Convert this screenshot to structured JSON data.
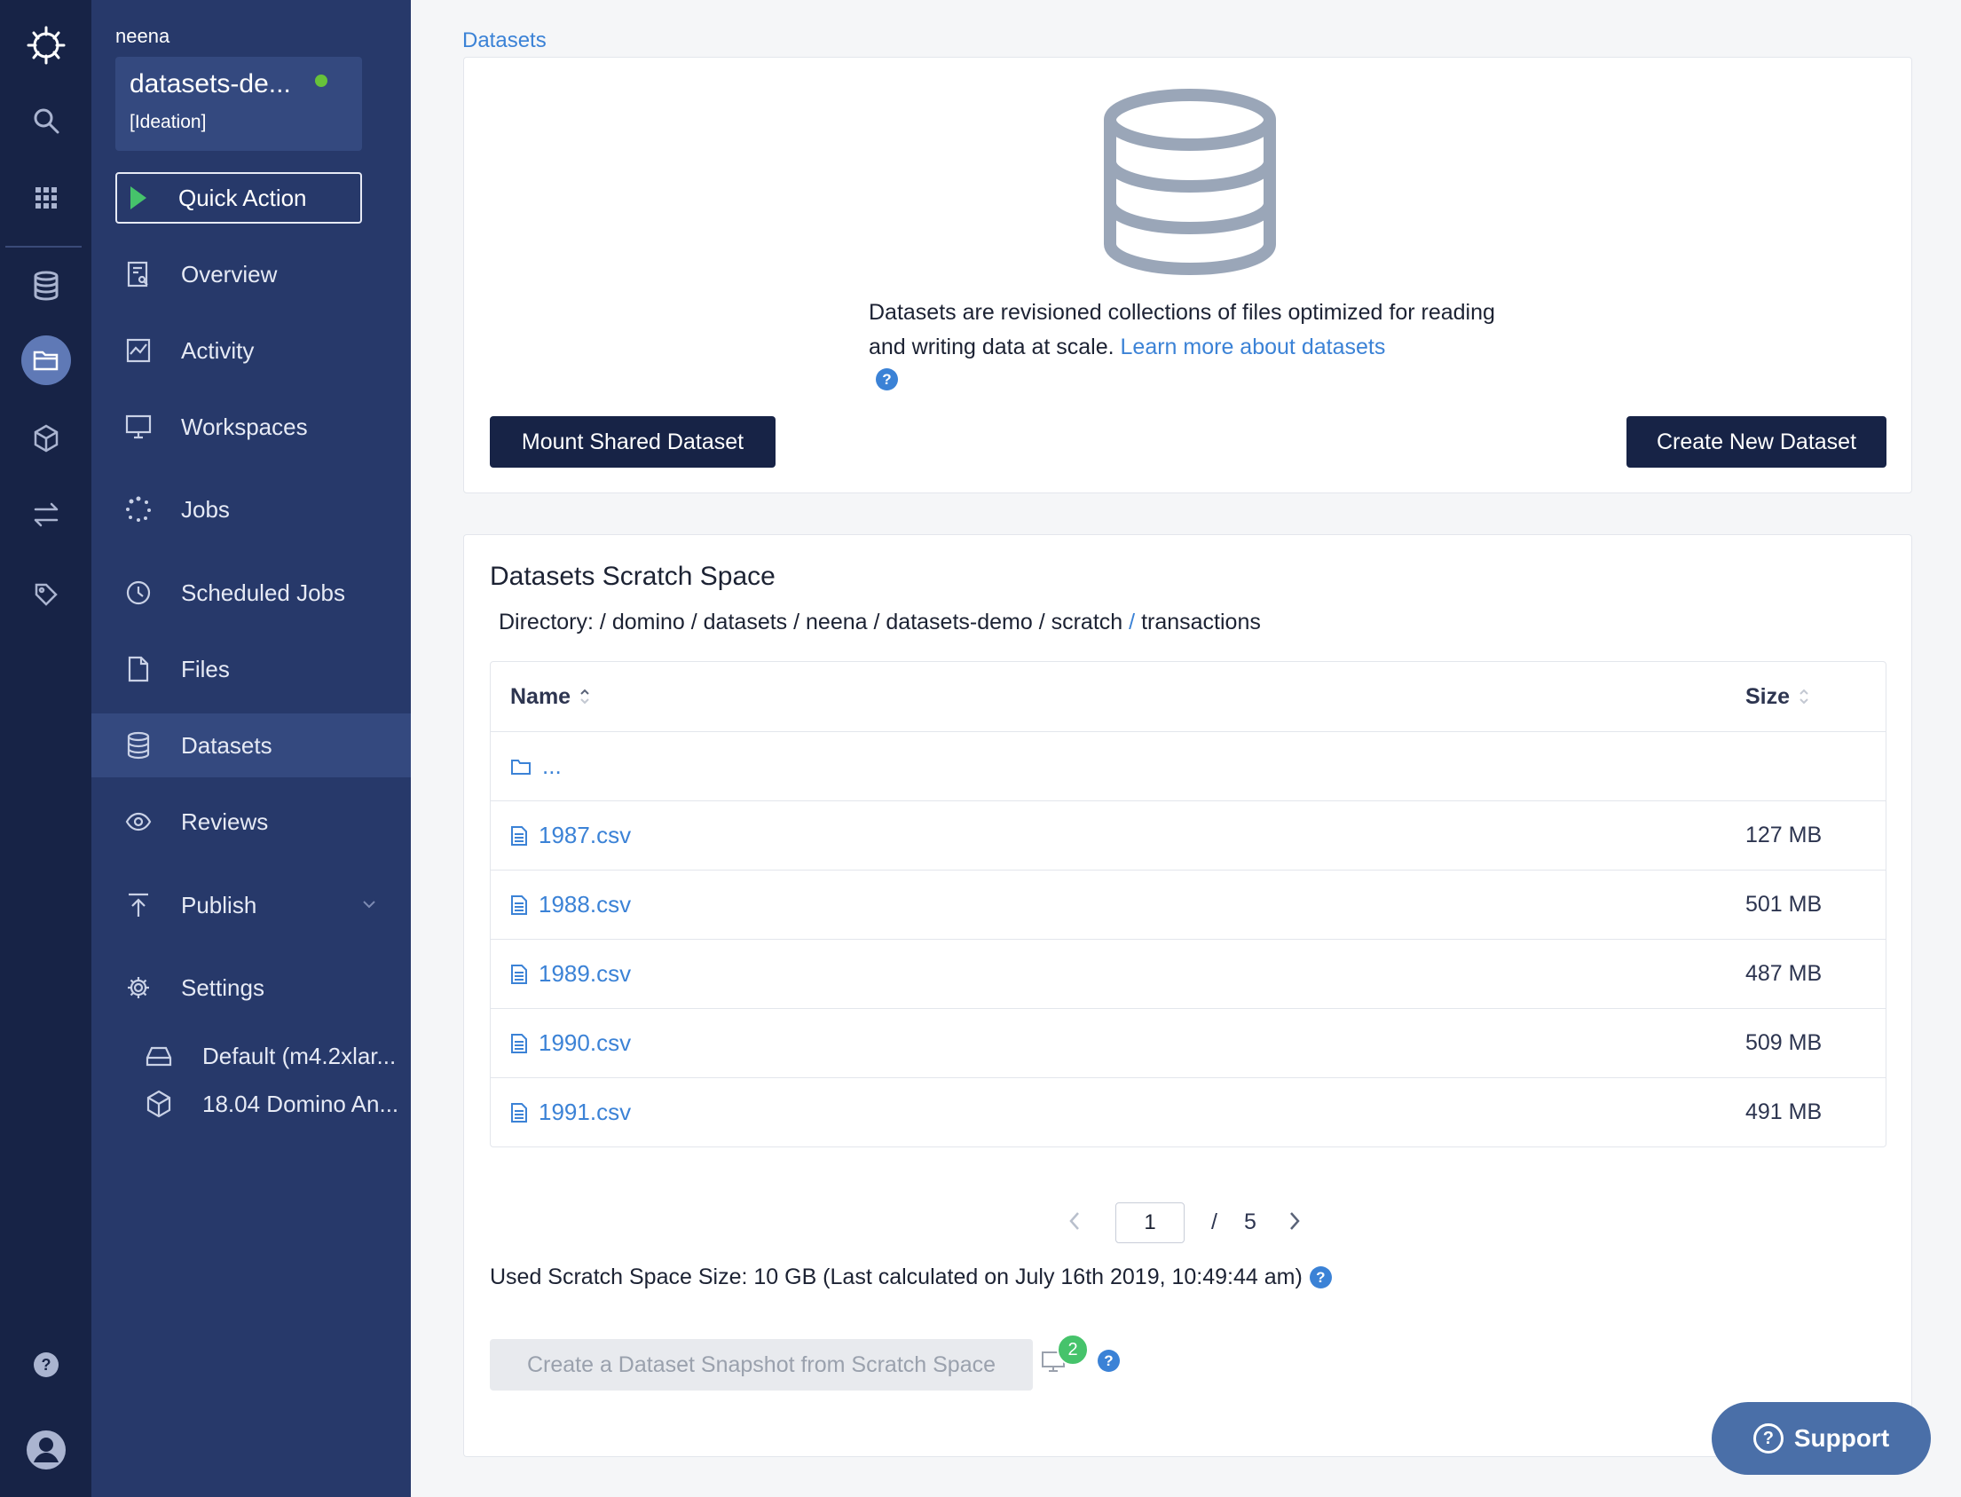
{
  "rail": {
    "icons": [
      "domino-logo-icon",
      "search-icon",
      "apps-grid-icon",
      "database-icon",
      "folder-icon",
      "cube-icon",
      "transfer-icon",
      "tag-icon",
      "help-icon",
      "user-avatar-icon"
    ]
  },
  "sidebar": {
    "owner": "neena",
    "project_name": "datasets-de...",
    "project_stage": "[Ideation]",
    "quick_action": "Quick Action",
    "items": [
      {
        "label": "Overview",
        "icon": "overview-icon"
      },
      {
        "label": "Activity",
        "icon": "activity-icon"
      },
      {
        "label": "Workspaces",
        "icon": "monitor-icon"
      },
      {
        "label": "Jobs",
        "icon": "jobs-spinner-icon"
      },
      {
        "label": "Scheduled Jobs",
        "icon": "clock-icon"
      },
      {
        "label": "Files",
        "icon": "file-icon"
      },
      {
        "label": "Datasets",
        "icon": "database-icon"
      },
      {
        "label": "Reviews",
        "icon": "eye-icon"
      },
      {
        "label": "Publish",
        "icon": "publish-icon"
      },
      {
        "label": "Settings",
        "icon": "gear-icon"
      }
    ],
    "hardware_tier": "Default (m4.2xlar...",
    "environment": "18.04 Domino An..."
  },
  "breadcrumb": "Datasets",
  "intro": {
    "text": "Datasets are revisioned collections of files optimized for reading and writing data at scale.",
    "link": "Learn more about datasets",
    "mount_button": "Mount Shared Dataset",
    "create_button": "Create New Dataset"
  },
  "scratch": {
    "title": "Datasets Scratch Space",
    "dir_label": "Directory:",
    "dir_parts": [
      "domino",
      "datasets",
      "neena",
      "datasets-demo",
      "scratch",
      "transactions"
    ],
    "columns": {
      "name": "Name",
      "size": "Size"
    },
    "parent_label": "...",
    "rows": [
      {
        "name": "1987.csv",
        "size": "127 MB"
      },
      {
        "name": "1988.csv",
        "size": "501 MB"
      },
      {
        "name": "1989.csv",
        "size": "487 MB"
      },
      {
        "name": "1990.csv",
        "size": "509 MB"
      },
      {
        "name": "1991.csv",
        "size": "491 MB"
      }
    ],
    "pagination": {
      "current": "1",
      "slash": "/",
      "total": "5"
    },
    "used_size": "Used Scratch Space Size: 10 GB (Last calculated on July 16th 2019, 10:49:44 am)",
    "snapshot_button": "Create a Dataset Snapshot from Scratch Space",
    "badge_count": "2"
  },
  "support": "Support",
  "colors": {
    "rail_bg": "#172346",
    "sidebar_bg": "#27396a",
    "accent_blue": "#3b82d6",
    "success_green": "#46c36b"
  }
}
